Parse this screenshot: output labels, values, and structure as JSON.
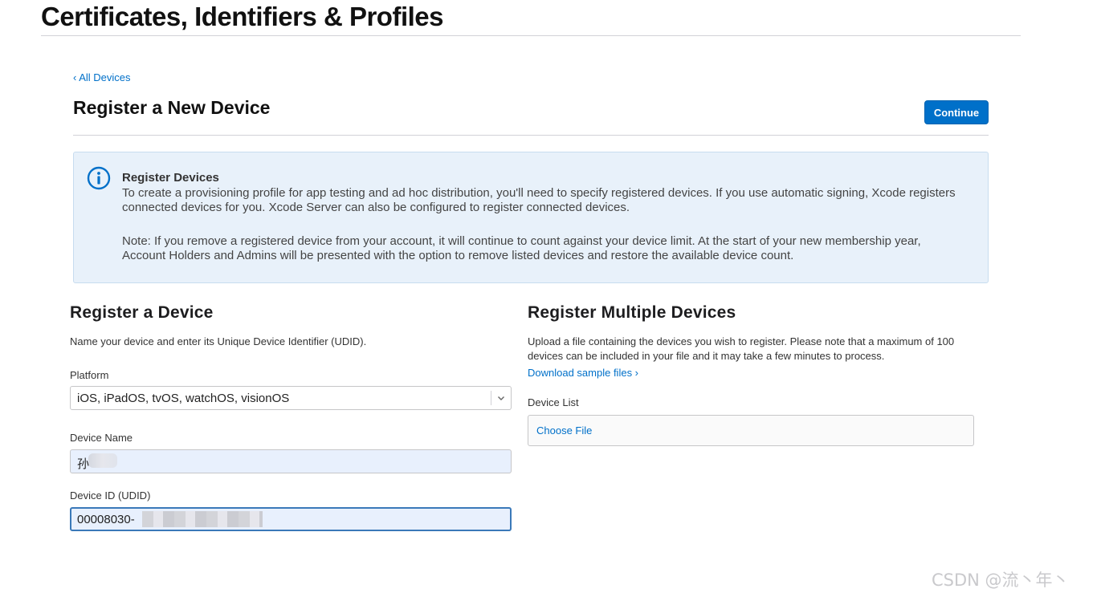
{
  "header": {
    "title": "Certificates, Identifiers & Profiles"
  },
  "breadcrumb": {
    "back_label": "‹ All Devices"
  },
  "page": {
    "title": "Register a New Device",
    "continue_label": "Continue"
  },
  "info": {
    "heading": "Register Devices",
    "paragraph1": "To create a provisioning profile for app testing and ad hoc distribution, you'll need to specify registered devices. If you use automatic signing, Xcode registers connected devices for you. Xcode Server can also be configured to register connected devices.",
    "paragraph2": "Note: If you remove a registered device from your account, it will continue to count against your device limit. At the start of your new membership year, Account Holders and Admins will be presented with the option to remove listed devices and restore the available device count.",
    "icon": "info-circle-icon",
    "icon_color": "#0070c9"
  },
  "single": {
    "title": "Register a Device",
    "description": "Name your device and enter its Unique Device Identifier (UDID).",
    "platform_label": "Platform",
    "platform_value": "iOS, iPadOS, tvOS, watchOS, visionOS",
    "name_label": "Device Name",
    "name_value": "孙",
    "udid_label": "Device ID (UDID)",
    "udid_value": "00008030-"
  },
  "multiple": {
    "title": "Register Multiple Devices",
    "description": "Upload a file containing the devices you wish to register. Please note that a maximum of 100 devices can be included in your file and it may take a few minutes to process.",
    "sample_link": "Download sample files ›",
    "list_label": "Device List",
    "choose_file": "Choose File"
  },
  "watermark": {
    "text": "CSDN @流丶年丶"
  },
  "colors": {
    "accent": "#0070c9",
    "info_background": "#e8f1fa",
    "input_autofill": "#e8f0fd"
  }
}
